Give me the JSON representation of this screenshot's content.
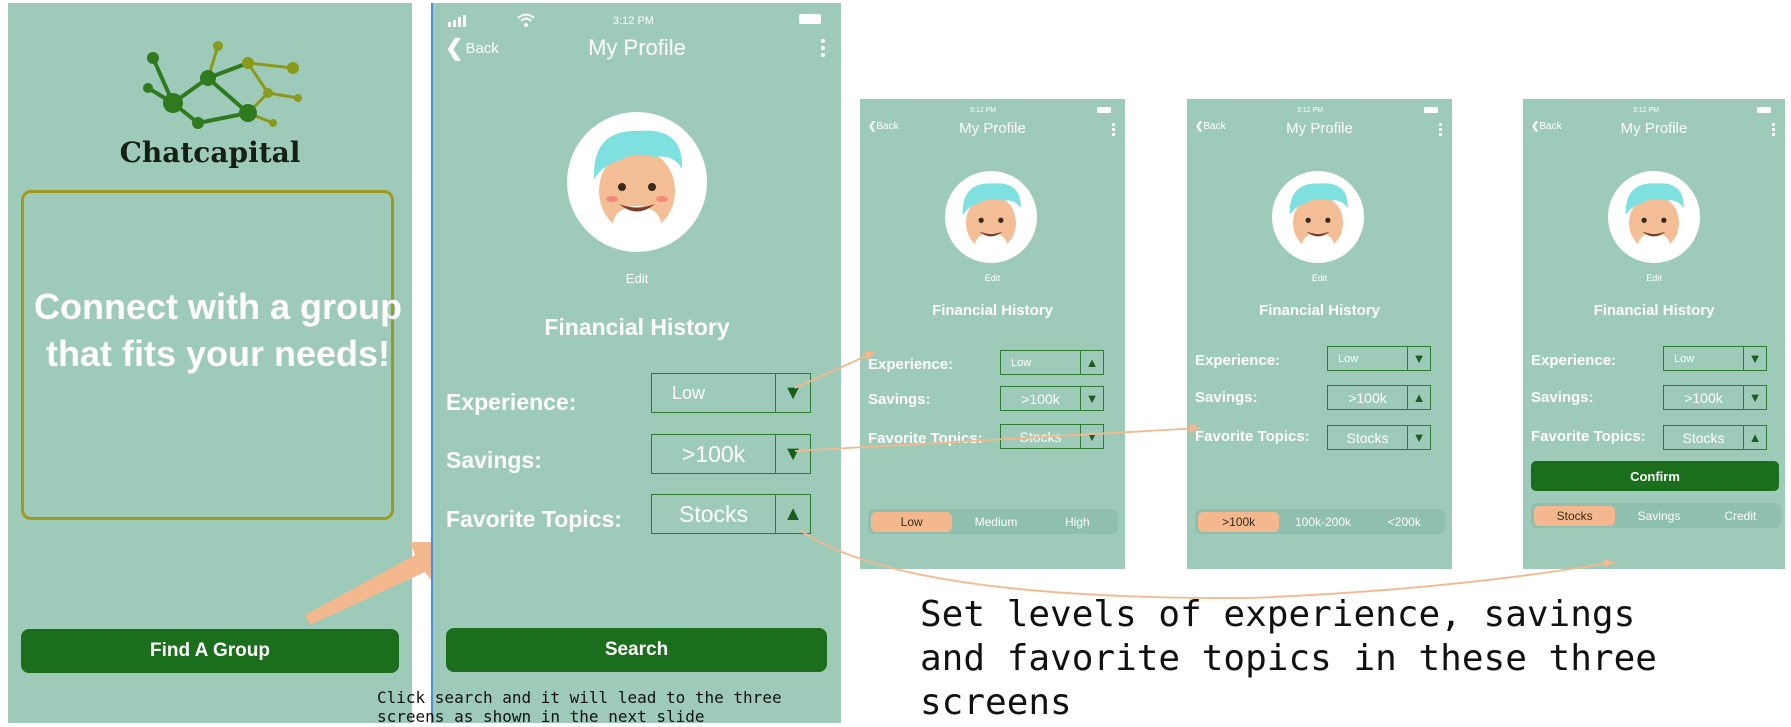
{
  "colors": {
    "screen": "#9ecbb9",
    "button": "#1b6e1b",
    "highlight": "#f3b88e",
    "frame": "#a09a1a"
  },
  "welcome": {
    "app_name": "Chatcapital",
    "headline": "Connect with a group that fits your needs!",
    "button": "Find A Group"
  },
  "statusbar": {
    "time": "3:12 PM"
  },
  "profile": {
    "back": "Back",
    "title": "My Profile",
    "edit": "Edit",
    "section": "Financial History",
    "experience_label": "Experience:",
    "savings_label": "Savings:",
    "topics_label": "Favorite Topics:",
    "search": "Search"
  },
  "main_values": {
    "experience": "Low",
    "savings": ">100k",
    "topics": "Stocks"
  },
  "screen2": {
    "experience": "Low",
    "savings": ">100k",
    "topics": "Stocks",
    "options": [
      "Low",
      "Medium",
      "High"
    ],
    "selected": "Low"
  },
  "screen3": {
    "experience": "Low",
    "savings": ">100k",
    "topics": "Stocks",
    "options": [
      ">100k",
      "100k-200k",
      "<200k"
    ],
    "selected": ">100k"
  },
  "screen4": {
    "experience": "Low",
    "savings": ">100k",
    "topics": "Stocks",
    "confirm": "Confirm",
    "options": [
      "Stocks",
      "Savings",
      "Credit"
    ],
    "selected": "Stocks"
  },
  "notes": {
    "search_note": "Click search and it will lead to the three screens as shown in the next slide",
    "main_note": "Set levels of experience, savings and favorite topics in these three screens"
  }
}
